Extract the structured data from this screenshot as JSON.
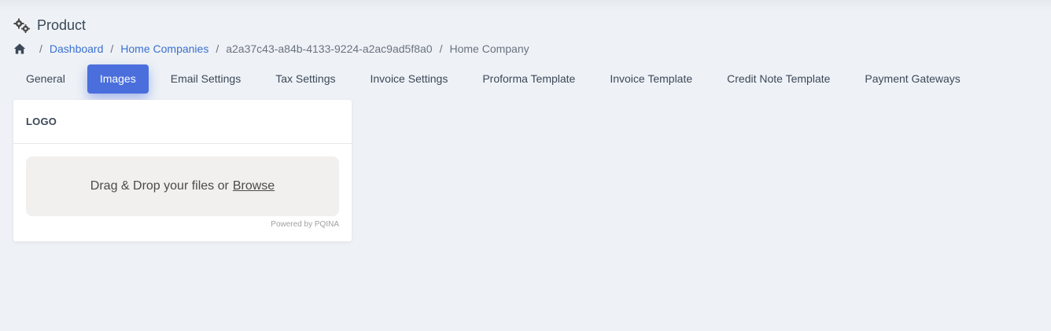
{
  "header": {
    "title": "Product",
    "icon": "gears-icon"
  },
  "breadcrumb": {
    "home_icon": "home-icon",
    "separator": "/",
    "items": [
      "Dashboard",
      "Home Companies",
      "a2a37c43-a84b-4133-9224-a2ac9ad5f8a0",
      "Home Company"
    ]
  },
  "tabs": [
    {
      "label": "General"
    },
    {
      "label": "Images"
    },
    {
      "label": "Email Settings"
    },
    {
      "label": "Tax Settings"
    },
    {
      "label": "Invoice Settings"
    },
    {
      "label": "Proforma Template"
    },
    {
      "label": "Invoice Template"
    },
    {
      "label": "Credit Note Template"
    },
    {
      "label": "Payment Gateways"
    }
  ],
  "active_tab": "Images",
  "logo_card": {
    "title": "LOGO",
    "dropzone_text": "Drag & Drop your files or",
    "browse_label": "Browse",
    "powered_by": "Powered by PQINA"
  },
  "colors": {
    "accent": "#4a6fdc",
    "link": "#3b6fd1",
    "background": "#eef2f6"
  }
}
